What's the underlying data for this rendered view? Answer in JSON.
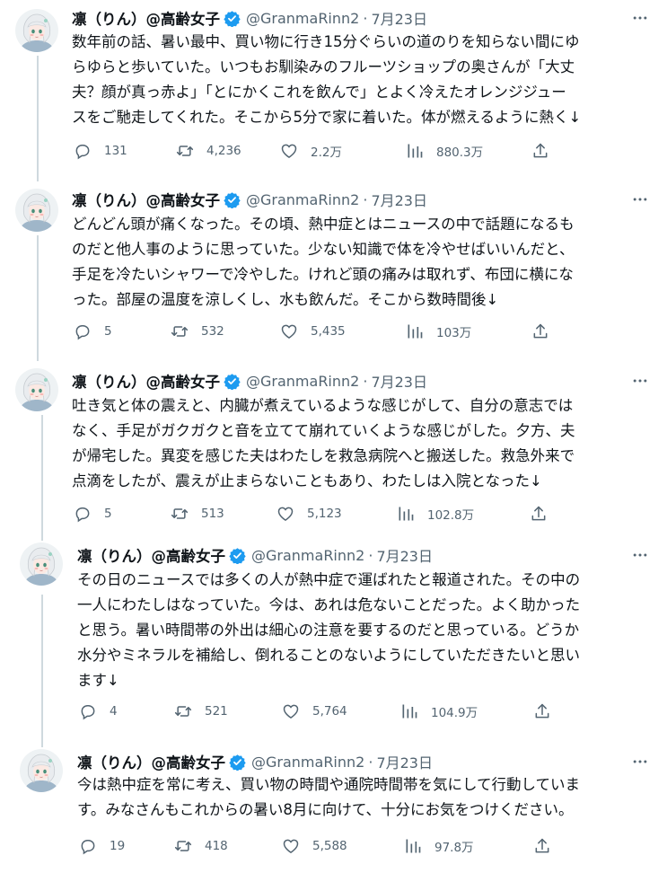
{
  "author": {
    "display_name": "凛（りん）@高齢女子",
    "handle": "@GranmaRinn2",
    "separator": "·",
    "date": "7月23日"
  },
  "colors": {
    "verified": "#1d9bf0",
    "muted": "#536471",
    "text": "#0f1419"
  },
  "icons": {
    "reply": "reply-icon",
    "retweet": "retweet-icon",
    "like": "like-icon",
    "views": "views-icon",
    "share": "share-icon",
    "more": "more-icon"
  },
  "tweets": [
    {
      "text": "数年前の話、暑い最中、買い物に行き15分ぐらいの道のりを知らない間にゆ\nらゆらと歩いていた。いつもお馴染みのフルーツショップの奥さんが「大丈\n夫？顔が真っ赤よ」「とにかくこれを飲んで」とよく冷えたオレンジジュー\nスをご馳走してくれた。そこから5分で家に着いた。体が燃えるように熱く↓",
      "replies": "131",
      "retweets": "4,236",
      "likes": "2.2万",
      "views": "880.3万"
    },
    {
      "text": "どんどん頭が痛くなった。その頃、熱中症とはニュースの中で話題になるも\nのだと他人事のように思っていた。少ない知識で体を冷やせばいいんだと、\n手足を冷たいシャワーで冷やした。けれど頭の痛みは取れず、布団に横にな\nった。部屋の温度を涼しくし、水も飲んだ。そこから数時間後↓",
      "replies": "5",
      "retweets": "532",
      "likes": "5,435",
      "views": "103万"
    },
    {
      "text": "吐き気と体の震えと、内臓が煮えているような感じがして、自分の意志では\nなく、手足がガクガクと音を立てて崩れていくような感じがした。夕方、夫\nが帰宅した。異変を感じた夫はわたしを救急病院へと搬送した。救急外来で\n点滴をしたが、震えが止まらないこともあり、わたしは入院となった↓",
      "replies": "5",
      "retweets": "513",
      "likes": "5,123",
      "views": "102.8万"
    },
    {
      "text": "その日のニュースでは多くの人が熱中症で運ばれたと報道された。その中の\n一人にわたしはなっていた。今は、あれは危ないことだった。よく助かった\nと思う。暑い時間帯の外出は細心の注意を要するのだと思っている。どうか\n水分やミネラルを補給し、倒れることのないようにしていただきたいと思い\nます↓",
      "replies": "4",
      "retweets": "521",
      "likes": "5,764",
      "views": "104.9万"
    },
    {
      "text": "今は熱中症を常に考え、買い物の時間や通院時間帯を気にして行動していま\nす。みなさんもこれからの暑い8月に向けて、十分にお気をつけください。",
      "replies": "19",
      "retweets": "418",
      "likes": "5,588",
      "views": "97.8万"
    }
  ]
}
